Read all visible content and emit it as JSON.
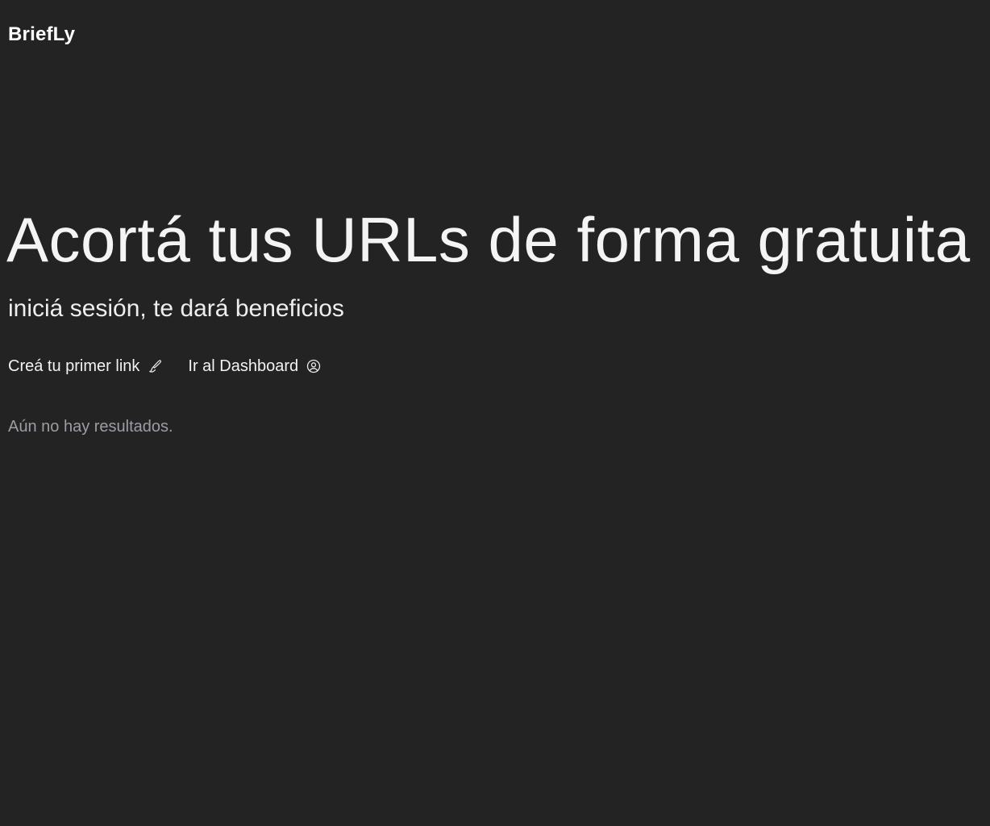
{
  "header": {
    "brand": "BriefLy"
  },
  "hero": {
    "title": "Acortá tus URLs de forma gratuita",
    "subtitle": "iniciá sesión, te dará beneficios"
  },
  "actions": [
    {
      "label": "Creá tu primer link",
      "icon": "brush-icon"
    },
    {
      "label": "Ir al Dashboard",
      "icon": "user-circle-icon"
    }
  ],
  "results": {
    "empty_text": "Aún no hay resultados."
  },
  "colors": {
    "background": "#232323",
    "text": "#f2f2f2",
    "muted": "#9a9ea4"
  }
}
